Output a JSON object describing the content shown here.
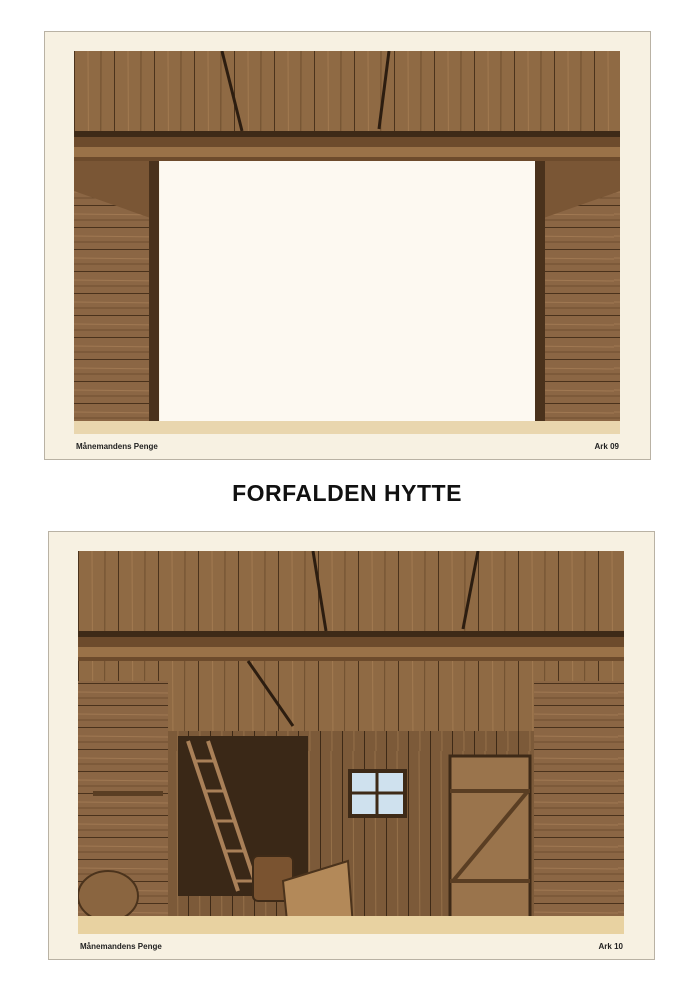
{
  "sheets": [
    {
      "footer_title": "Månemandens Penge",
      "sheet_label": "Ark 09"
    },
    {
      "footer_title": "Månemandens Penge",
      "sheet_label": "Ark 10"
    }
  ],
  "heading": "FORFALDEN HYTTE",
  "colors": {
    "paper": "#f7f1e2",
    "wood_dark": "#5b3f23",
    "wood_mid": "#8a6540",
    "wood_light": "#b58d5e",
    "cutout": "#fdf9f1"
  }
}
